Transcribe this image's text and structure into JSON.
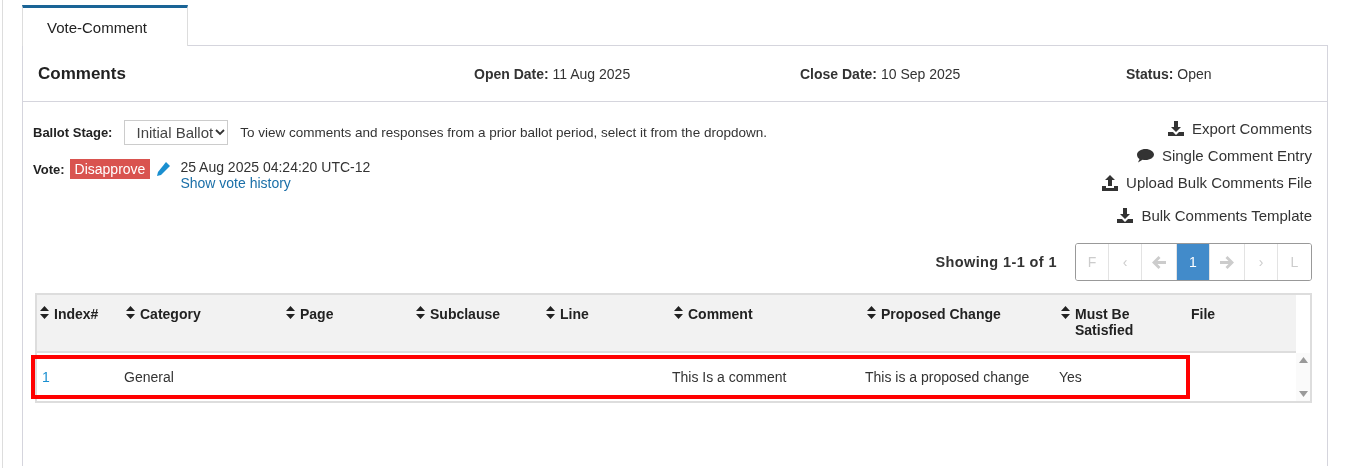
{
  "tabs": [
    {
      "label": "Vote-Comment",
      "selected": true
    }
  ],
  "header": {
    "title": "Comments",
    "fields": [
      {
        "label": "Open Date:",
        "value": "11 Aug 2025"
      },
      {
        "label": "Close Date:",
        "value": "10 Sep 2025"
      },
      {
        "label": "Status:",
        "value": "Open"
      }
    ]
  },
  "ballot_stage": {
    "label": "Ballot Stage:",
    "value": "Initial Ballot",
    "hint": "To view comments and responses from a prior ballot period, select it from the dropdown."
  },
  "vote": {
    "label": "Vote:",
    "value": "Disapprove",
    "timestamp": "25 Aug 2025 04:24:20 UTC-12",
    "history_link": "Show vote history"
  },
  "actions": [
    {
      "kind": "download",
      "label": "Export Comments"
    },
    {
      "kind": "comment",
      "label": "Single Comment Entry"
    },
    {
      "kind": "upload",
      "label": "Upload Bulk Comments File"
    },
    {
      "kind": "download",
      "label": "Bulk Comments Template"
    }
  ],
  "pagination": {
    "summary": "Showing 1-1 of 1",
    "pages": [
      {
        "label": "F",
        "kind": "text",
        "disabled": true,
        "selected": false
      },
      {
        "label": "‹",
        "kind": "text",
        "disabled": true,
        "selected": false
      },
      {
        "kind": "prev",
        "disabled": true,
        "selected": false
      },
      {
        "label": "1",
        "kind": "text",
        "disabled": false,
        "selected": true
      },
      {
        "kind": "next",
        "disabled": true,
        "selected": false
      },
      {
        "label": "›",
        "kind": "text",
        "disabled": true,
        "selected": false
      },
      {
        "label": "L",
        "kind": "text",
        "disabled": true,
        "selected": false
      }
    ]
  },
  "table": {
    "columns": [
      {
        "label": "Index#",
        "sortable": true
      },
      {
        "label": "Category",
        "sortable": true
      },
      {
        "label": "Page",
        "sortable": true
      },
      {
        "label": "Subclause",
        "sortable": true
      },
      {
        "label": "Line",
        "sortable": true
      },
      {
        "label": "Comment",
        "sortable": true
      },
      {
        "label": "Proposed Change",
        "sortable": true
      },
      {
        "label": "Must Be Satisfied",
        "sortable": true
      },
      {
        "label": "File",
        "sortable": false
      }
    ],
    "rows": [
      {
        "highlighted": true,
        "cells": [
          "1",
          "General",
          "",
          "",
          "",
          "This Is a comment",
          "This is a proposed change",
          "Yes",
          ""
        ]
      }
    ]
  }
}
